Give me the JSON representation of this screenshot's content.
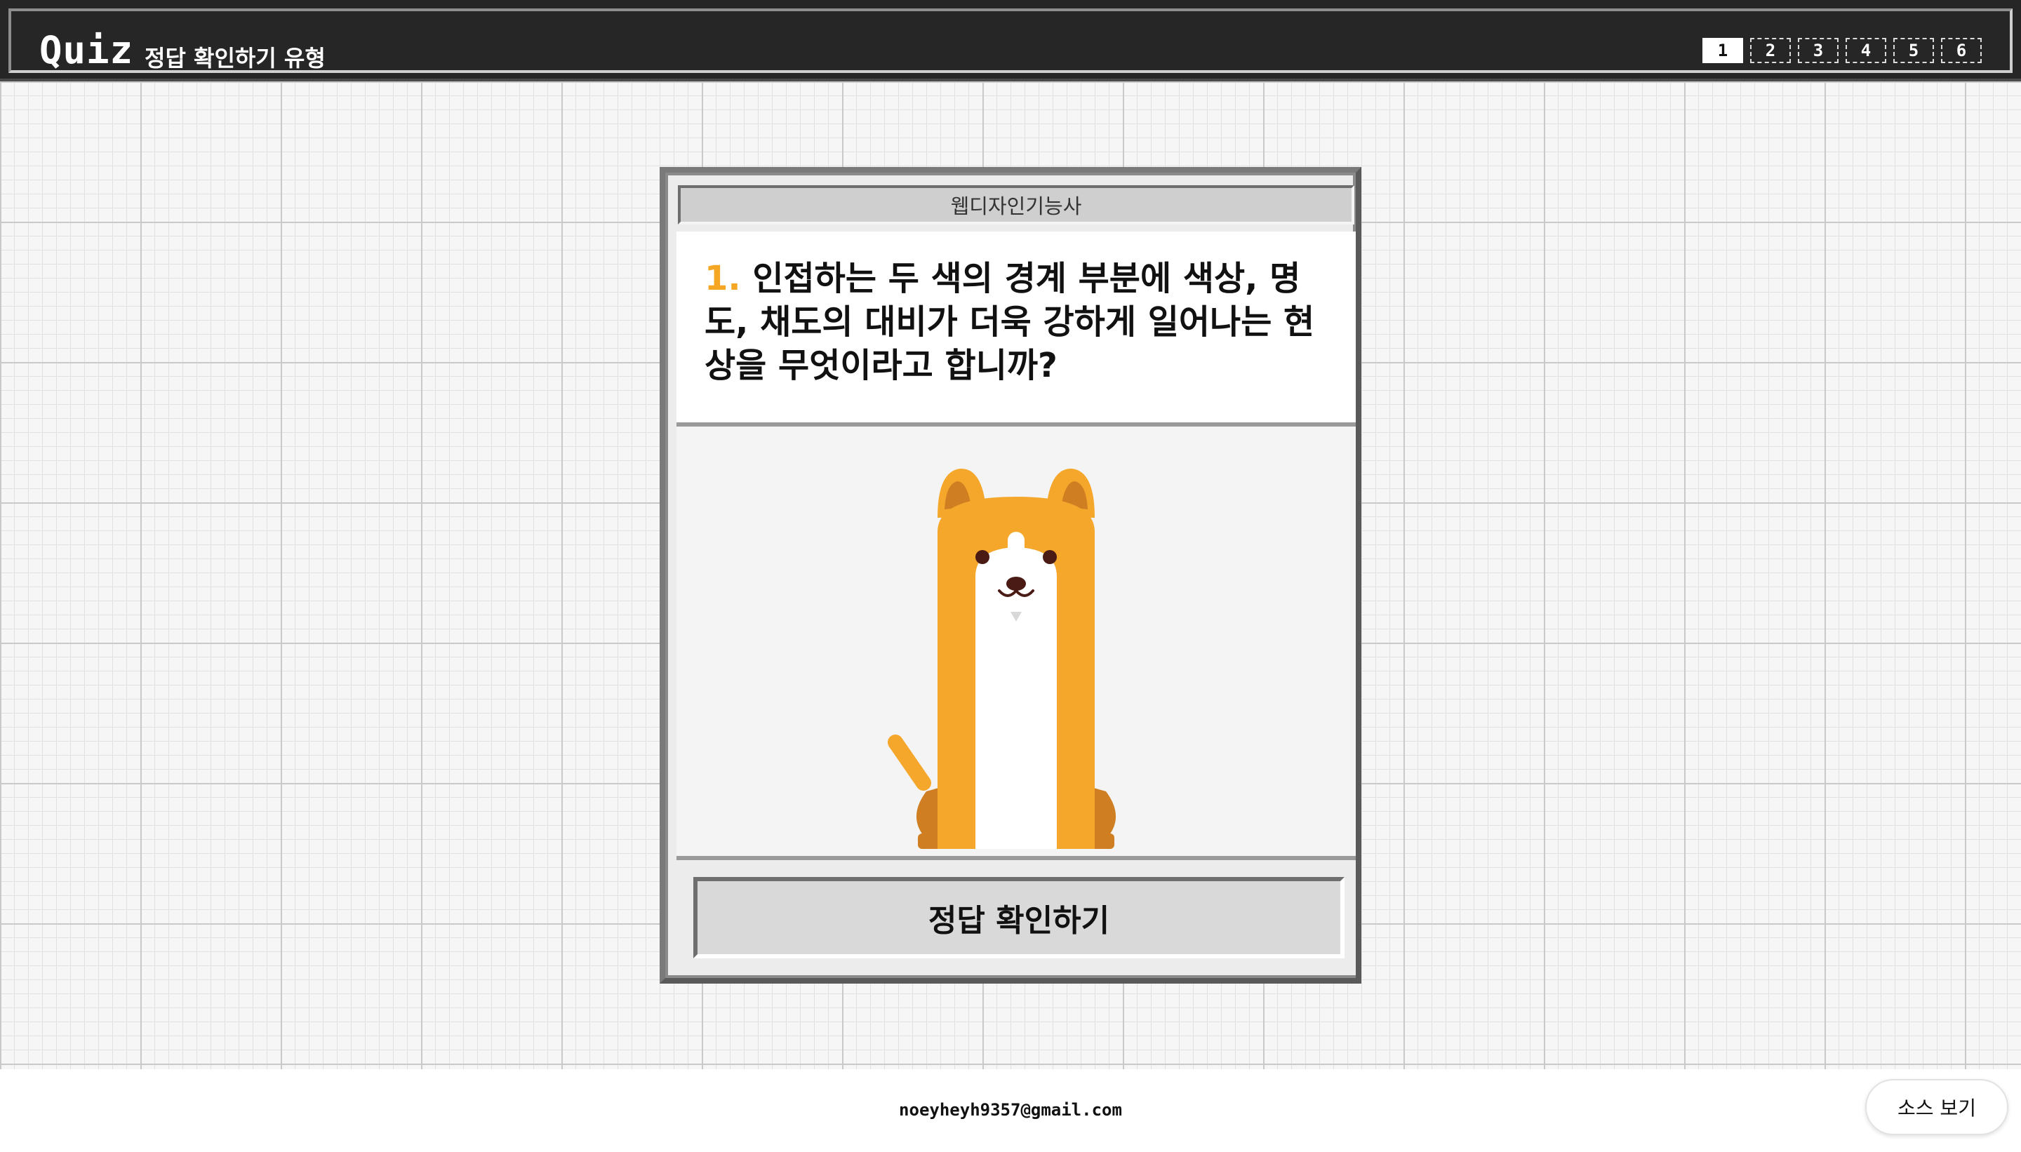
{
  "header": {
    "logo": "Quiz",
    "subtitle": "정답 확인하기 유형",
    "pages": [
      "1",
      "2",
      "3",
      "4",
      "5",
      "6"
    ],
    "active_page": "1"
  },
  "quiz": {
    "category": "웹디자인기능사",
    "question_number": "1.",
    "question_text": "인접하는 두 색의 경계 부분에 색상, 명도, 채도의 대비가 더욱 강하게 일어나는 현상을 무엇이라고 합니까?",
    "image_icon": "corgi-dog-illustration",
    "answer_button_label": "정답 확인하기"
  },
  "footer": {
    "email": "noeyheyh9357@gmail.com",
    "source_button_label": "소스 보기"
  },
  "colors": {
    "header_bg": "#262626",
    "accent_orange": "#f5a623",
    "dog_orange": "#f5a72b",
    "dog_dark_orange": "#cf7f22"
  }
}
